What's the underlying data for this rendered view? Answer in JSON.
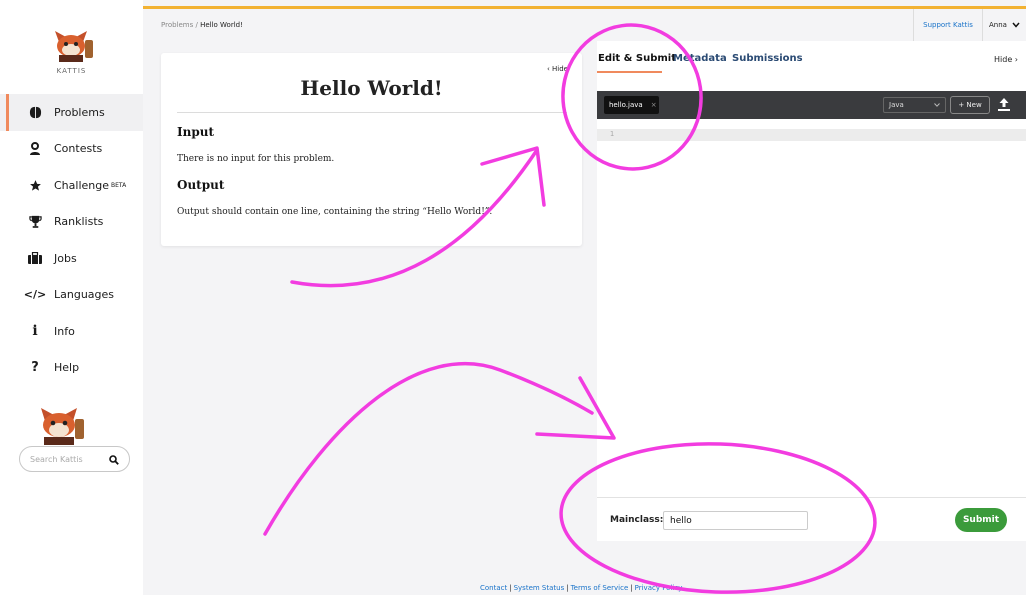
{
  "brand": {
    "name": "KATTIS"
  },
  "nav": {
    "items": [
      {
        "label": "Problems",
        "icon": "brain-icon",
        "active": true
      },
      {
        "label": "Contests",
        "icon": "person-icon"
      },
      {
        "label": "Challenge",
        "icon": "star-icon",
        "badge": "BETA"
      },
      {
        "label": "Ranklists",
        "icon": "trophy-icon"
      },
      {
        "label": "Jobs",
        "icon": "briefcase-icon"
      },
      {
        "label": "Languages",
        "icon": "code-icon"
      },
      {
        "label": "Info",
        "icon": "info-icon"
      },
      {
        "label": "Help",
        "icon": "question-icon"
      }
    ]
  },
  "search": {
    "placeholder": "Search Kattis"
  },
  "topbar": {
    "breadcrumb_parent": "Problems",
    "breadcrumb_sep": " / ",
    "breadcrumb_current": "Hello World!",
    "support": "Support Kattis",
    "user": "Anna"
  },
  "problem": {
    "title": "Hello World!",
    "hide": "‹ Hide",
    "input_heading": "Input",
    "input_text": "There is no input for this problem.",
    "output_heading": "Output",
    "output_text": "Output should contain one line, containing the string “Hello World!”."
  },
  "editor": {
    "tabs": [
      "Edit & Submit",
      "Metadata",
      "Submissions"
    ],
    "hide": "Hide ›",
    "file_name": "hello.java",
    "language": "Java",
    "new_label": "+ New",
    "line_number": "1",
    "mainclass_label": "Mainclass:",
    "mainclass_value": "hello",
    "submit_label": "Submit"
  },
  "footer": {
    "links": [
      "Contact",
      "System Status",
      "Terms of Service",
      "Privacy Policy"
    ]
  },
  "colors": {
    "accent": "#f08a5d",
    "topline": "#f2b233",
    "submit": "#3b9b3b",
    "annotation": "#f23ce0",
    "link": "#1a73c9"
  }
}
